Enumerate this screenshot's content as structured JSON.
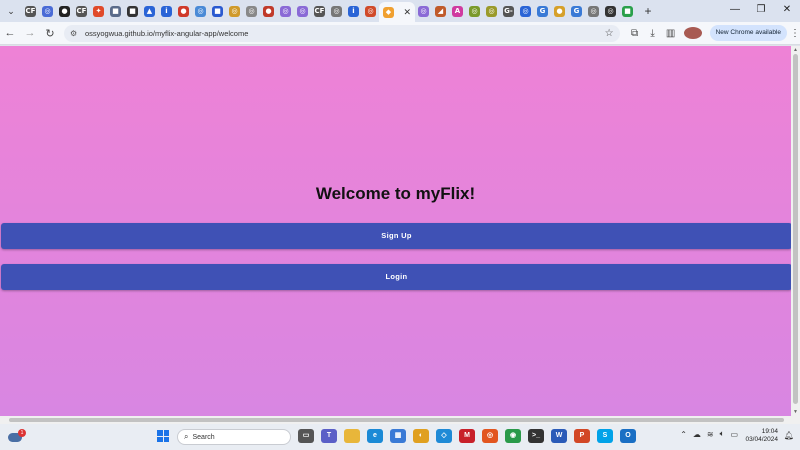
{
  "browser": {
    "url": "ossyogwua.github.io/myflix-angular-app/welcome",
    "update_label": "New Chrome available",
    "active_tab_close": "✕",
    "new_tab": "+",
    "window_controls": [
      "—",
      "❐",
      "✕"
    ]
  },
  "tabs": [
    {
      "icon": "CF",
      "color": "#555555"
    },
    {
      "icon": "◎",
      "color": "#4a6bd6"
    },
    {
      "icon": "●",
      "color": "#222222"
    },
    {
      "icon": "CF",
      "color": "#555555"
    },
    {
      "icon": "✦",
      "color": "#e04a2a"
    },
    {
      "icon": "■",
      "color": "#5a6b8a"
    },
    {
      "icon": "■",
      "color": "#333333"
    },
    {
      "icon": "▲",
      "color": "#2a64d6"
    },
    {
      "icon": "i",
      "color": "#2a64d6"
    },
    {
      "icon": "●",
      "color": "#d03a2a"
    },
    {
      "icon": "◎",
      "color": "#4a8ad6"
    },
    {
      "icon": "■",
      "color": "#2a5ad0"
    },
    {
      "icon": "◎",
      "color": "#d09a2a"
    },
    {
      "icon": "◎",
      "color": "#888888"
    },
    {
      "icon": "●",
      "color": "#c03a2a"
    },
    {
      "icon": "◎",
      "color": "#8a6ad6"
    },
    {
      "icon": "◎",
      "color": "#8a6ad6"
    },
    {
      "icon": "CF",
      "color": "#555555"
    },
    {
      "icon": "◎",
      "color": "#777777"
    },
    {
      "icon": "i",
      "color": "#2a64d6"
    },
    {
      "icon": "◎",
      "color": "#d04a2a"
    }
  ],
  "tabs_after": [
    {
      "icon": "◎",
      "color": "#8a6ad6"
    },
    {
      "icon": "◢",
      "color": "#c05a2a"
    },
    {
      "icon": "A",
      "color": "#d03aa0"
    },
    {
      "icon": "◎",
      "color": "#7a9a2a"
    },
    {
      "icon": "◎",
      "color": "#9a9a2a"
    },
    {
      "icon": "G-",
      "color": "#555555"
    },
    {
      "icon": "◎",
      "color": "#2a64d6"
    },
    {
      "icon": "G",
      "color": "#3a7ad6"
    },
    {
      "icon": "●",
      "color": "#d6a02a"
    },
    {
      "icon": "G",
      "color": "#3a7ad6"
    },
    {
      "icon": "◎",
      "color": "#777777"
    },
    {
      "icon": "◎",
      "color": "#333333"
    },
    {
      "icon": "■",
      "color": "#2aa04a"
    }
  ],
  "page": {
    "heading": "Welcome to myFlix!",
    "signup_label": "Sign Up",
    "login_label": "Login"
  },
  "taskbar": {
    "search_label": "Search",
    "weather_badge": "1",
    "time": "19:04",
    "date": "03/04/2024",
    "apps": [
      {
        "name": "task-view",
        "glyph": "▭",
        "color": "#555555"
      },
      {
        "name": "teams",
        "glyph": "T",
        "color": "#5b5fc7"
      },
      {
        "name": "file-explorer",
        "glyph": "",
        "color": "#e8b63a"
      },
      {
        "name": "edge",
        "glyph": "e",
        "color": "#1b8ad6"
      },
      {
        "name": "store",
        "glyph": "▦",
        "color": "#3a7ad6"
      },
      {
        "name": "chrome-canary",
        "glyph": "◐",
        "color": "#e0a020"
      },
      {
        "name": "vscode",
        "glyph": "◇",
        "color": "#1f8ad6"
      },
      {
        "name": "mcafee",
        "glyph": "M",
        "color": "#c8202a"
      },
      {
        "name": "ubuntu",
        "glyph": "◎",
        "color": "#e2551f"
      },
      {
        "name": "chrome",
        "glyph": "◉",
        "color": "#2a9a4a"
      },
      {
        "name": "terminal",
        "glyph": ">_",
        "color": "#333333"
      },
      {
        "name": "word",
        "glyph": "W",
        "color": "#2b5bb8"
      },
      {
        "name": "powerpoint",
        "glyph": "P",
        "color": "#d24726"
      },
      {
        "name": "skype",
        "glyph": "S",
        "color": "#00a2e8"
      },
      {
        "name": "outlook",
        "glyph": "O",
        "color": "#1a6fc4"
      }
    ]
  }
}
